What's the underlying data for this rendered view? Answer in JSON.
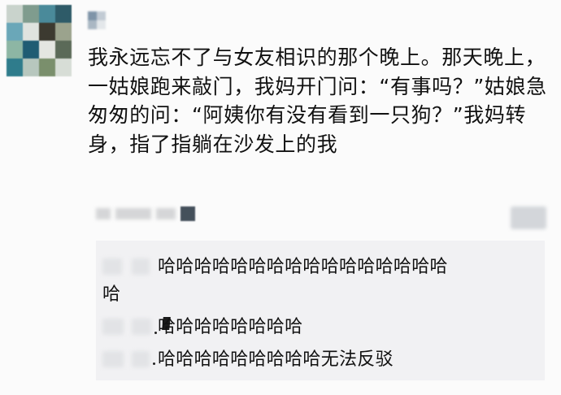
{
  "post": {
    "text": "我永远忘不了与女友相识的那个晚上。那天晚上，一姑娘跑来敲门，我妈开门问：“有事吗？”姑娘急匆匆的问：“阿姨你有没有看到一只狗？”我妈转身，指了指躺在沙发上的我"
  },
  "comments": [
    {
      "text_line1": "哈哈哈哈哈哈哈哈哈哈哈哈哈哈哈哈",
      "text_line2": "哈"
    },
    {
      "text": "哈哈哈哈哈哈哈哈"
    },
    {
      "text": "哈哈哈哈哈哈哈哈哈无法反驳"
    }
  ],
  "colors": {
    "background": "#fbfbfb",
    "comment_area": "#f1f1f3",
    "text": "#111111"
  }
}
